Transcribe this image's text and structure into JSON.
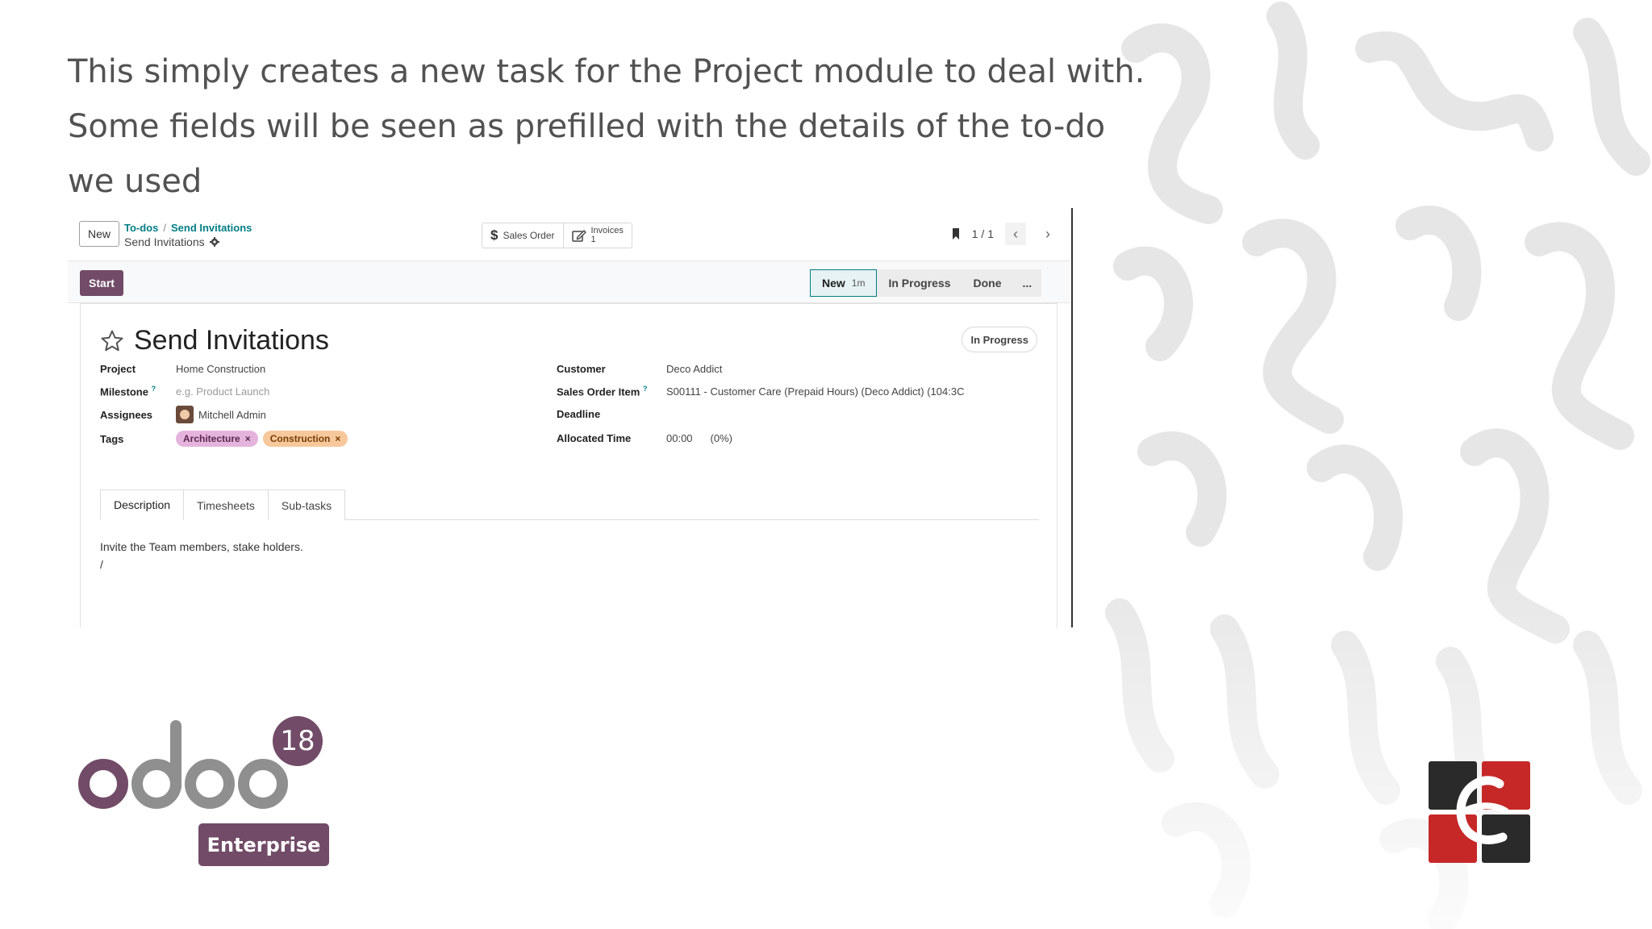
{
  "caption": {
    "line1": "This simply creates a new task for the Project module to deal with.",
    "line2": "Some fields will be seen as prefilled with the details of the to-do",
    "line3": "we used"
  },
  "control_panel": {
    "new_button": "New",
    "breadcrumb_parent": "To-dos",
    "breadcrumb_sep": "/",
    "breadcrumb_current": "Send Invitations",
    "record_name": "Send Invitations",
    "smart_buttons": [
      {
        "label": "Sales Order",
        "icon": "dollar-icon"
      },
      {
        "label": "Invoices",
        "count": "1",
        "icon": "edit-icon"
      }
    ],
    "pager": "1 / 1"
  },
  "statusbar": {
    "start_button": "Start",
    "stages": [
      {
        "label": "New",
        "duration": "1m",
        "active": true
      },
      {
        "label": "In Progress"
      },
      {
        "label": "Done"
      },
      {
        "label": "..."
      }
    ]
  },
  "form": {
    "title": "Send Invitations",
    "state_badge": "In Progress",
    "left_fields": {
      "project_label": "Project",
      "project_value": "Home Construction",
      "milestone_label": "Milestone",
      "milestone_help": "?",
      "milestone_placeholder": "e.g. Product Launch",
      "assignees_label": "Assignees",
      "assignees_value": "Mitchell Admin",
      "tags_label": "Tags",
      "tags": [
        "Architecture",
        "Construction"
      ]
    },
    "right_fields": {
      "customer_label": "Customer",
      "customer_value": "Deco Addict",
      "soi_label": "Sales Order Item",
      "soi_help": "?",
      "soi_value": "S00111 - Customer Care (Prepaid Hours) (Deco Addict) (104:3C",
      "deadline_label": "Deadline",
      "allocated_label": "Allocated Time",
      "allocated_value": "00:00",
      "allocated_pct": "(0%)"
    },
    "tabs": [
      "Description",
      "Timesheets",
      "Sub-tasks"
    ],
    "description": [
      "Invite the Team members, stake holders.",
      "/"
    ]
  },
  "logo": {
    "wordmark": "odoo",
    "version": "18",
    "edition": "Enterprise",
    "colors": {
      "purple": "#714b67",
      "gray": "#8f8f8f"
    }
  },
  "brand_mark": {
    "letter": "e",
    "colors": {
      "red": "#c62828",
      "dark": "#2a2a2a"
    }
  }
}
